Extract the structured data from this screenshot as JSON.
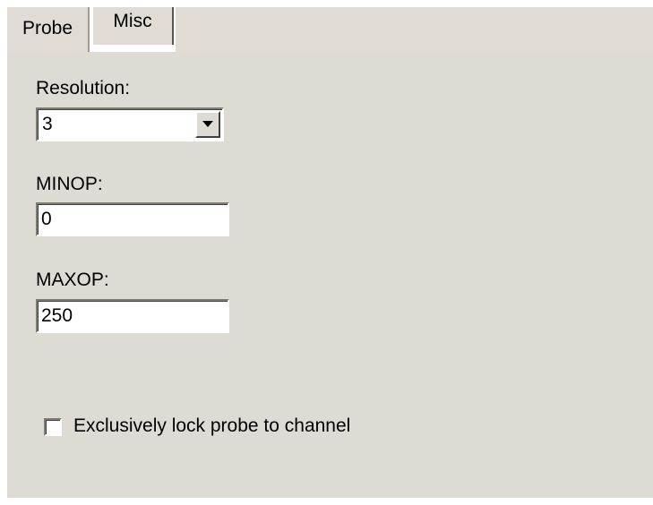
{
  "tabs": [
    {
      "label": "Probe",
      "selected": false
    },
    {
      "label": "Misc",
      "selected": true
    }
  ],
  "resolution": {
    "label": "Resolution:",
    "value": "3"
  },
  "minop": {
    "label": "MINOP:",
    "value": "0"
  },
  "maxop": {
    "label": "MAXOP:",
    "value": "250"
  },
  "lock_checkbox": {
    "label": "Exclusively lock probe to channel",
    "checked": false
  },
  "icons": {
    "dropdown": "chevron-down-icon"
  },
  "colors": {
    "panel_bg": "#dedbd4",
    "field_bg": "#ffffff"
  }
}
